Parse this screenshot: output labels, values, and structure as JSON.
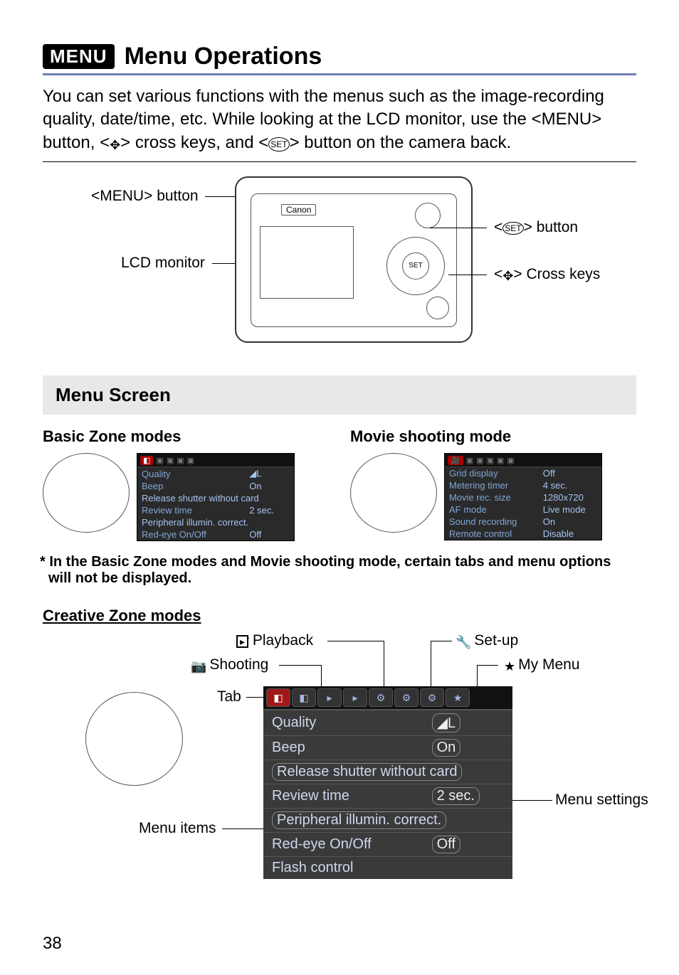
{
  "title": "Menu Operations",
  "menu_badge": "MENU",
  "intro": "You can set various functions with the menus such as the image-recording quality, date/time, etc. While looking at the LCD monitor, use the <MENU> button, <✥> cross keys, and <SET> button on the camera back.",
  "camera": {
    "brand": "Canon",
    "callouts": {
      "menu_button": "<MENU> button",
      "lcd_monitor": "LCD monitor",
      "set_button": "<SET> button",
      "cross_keys": "<✥> Cross keys"
    }
  },
  "menu_screen_header": "Menu Screen",
  "basic_zone_header": "Basic Zone modes",
  "movie_mode_header": "Movie shooting mode",
  "basic_zone_menu": [
    {
      "label": "Quality",
      "value": "◢L"
    },
    {
      "label": "Beep",
      "value": "On"
    },
    {
      "label": "Release shutter without card",
      "value": ""
    },
    {
      "label": "Review time",
      "value": "2 sec."
    },
    {
      "label": "Peripheral illumin. correct.",
      "value": ""
    },
    {
      "label": "Red-eye On/Off",
      "value": "Off"
    }
  ],
  "movie_menu": [
    {
      "label": "Grid display",
      "value": "Off"
    },
    {
      "label": "Metering timer",
      "value": "4 sec."
    },
    {
      "label": "Movie rec. size",
      "value": "1280x720"
    },
    {
      "label": "AF mode",
      "value": "Live mode"
    },
    {
      "label": "Sound recording",
      "value": "On"
    },
    {
      "label": "Remote control",
      "value": "Disable"
    }
  ],
  "footnote": "* In the Basic Zone modes and Movie shooting mode, certain tabs and menu options will not be displayed.",
  "creative_zone_header": "Creative Zone modes",
  "creative_callouts": {
    "playback": "Playback",
    "setup": "Set-up",
    "shooting": "Shooting",
    "mymenu": "My Menu",
    "tab": "Tab",
    "menu_items": "Menu items",
    "menu_settings": "Menu settings"
  },
  "creative_menu": [
    {
      "label": "Quality",
      "value": "◢L",
      "box": "val"
    },
    {
      "label": "Beep",
      "value": "On",
      "box": "val"
    },
    {
      "label": "Release shutter without card",
      "value": "",
      "box": "row"
    },
    {
      "label": "Review time",
      "value": "2 sec.",
      "box": "val"
    },
    {
      "label": "Peripheral illumin. correct.",
      "value": "",
      "box": "row"
    },
    {
      "label": "Red-eye On/Off",
      "value": "Off",
      "box": "val"
    },
    {
      "label": "Flash control",
      "value": "",
      "box": "none"
    }
  ],
  "page_number": "38"
}
